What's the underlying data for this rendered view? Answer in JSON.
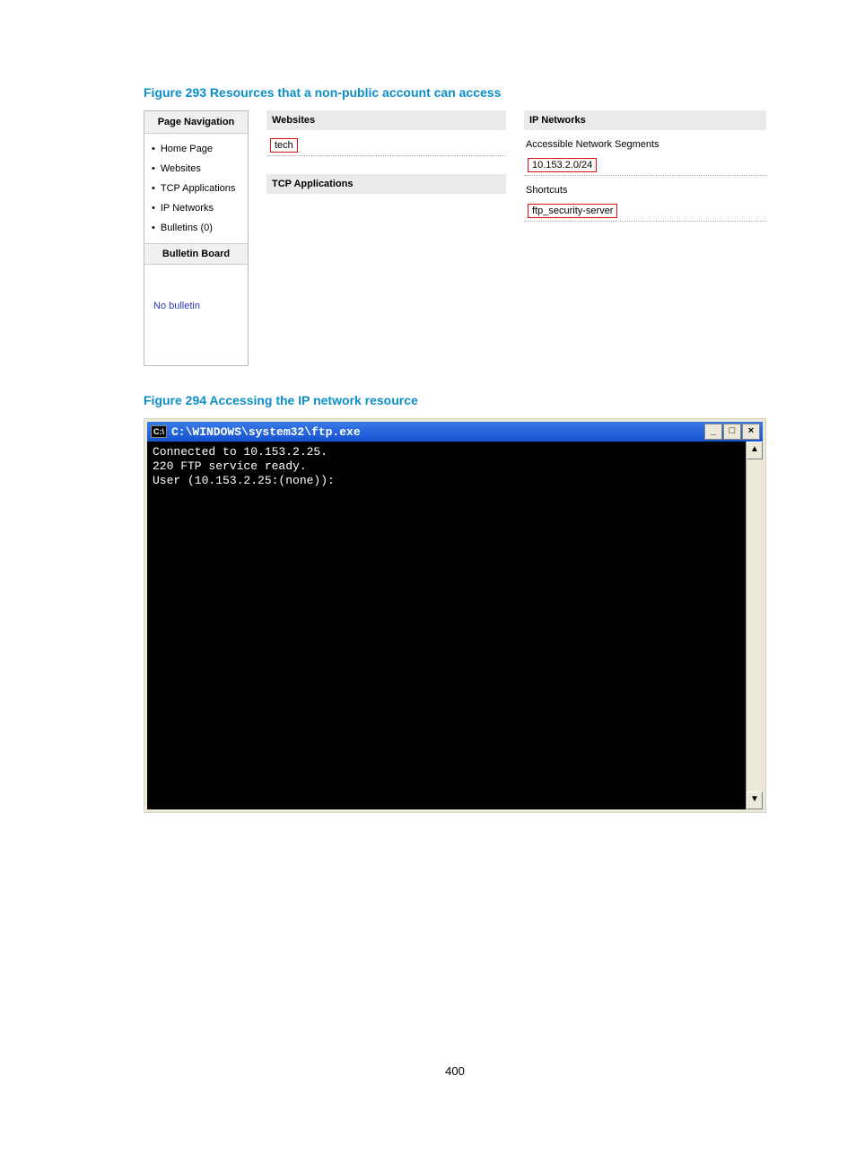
{
  "figure293": {
    "caption": "Figure 293 Resources that a non-public account can access",
    "sidebar": {
      "header": "Page Navigation",
      "items": [
        "Home Page",
        "Websites",
        "TCP Applications",
        "IP Networks",
        "Bulletins (0)"
      ],
      "bulletin_header": "Bulletin Board",
      "bulletin_text": "No bulletin"
    },
    "mid": {
      "websites_header": "Websites",
      "websites_value": "tech",
      "tcp_header": "TCP Applications"
    },
    "right": {
      "ip_header": "IP Networks",
      "segments_label": "Accessible Network Segments",
      "segment_value": "10.153.2.0/24",
      "shortcuts_label": "Shortcuts",
      "shortcut_value": "ftp_security-server"
    }
  },
  "figure294": {
    "caption": "Figure 294 Accessing the IP network resource",
    "title_icon": "C:\\",
    "title_text": "C:\\WINDOWS\\system32\\ftp.exe",
    "console_lines": "Connected to 10.153.2.25.\n220 FTP service ready.\nUser (10.153.2.25:(none)):"
  },
  "page_number": "400"
}
